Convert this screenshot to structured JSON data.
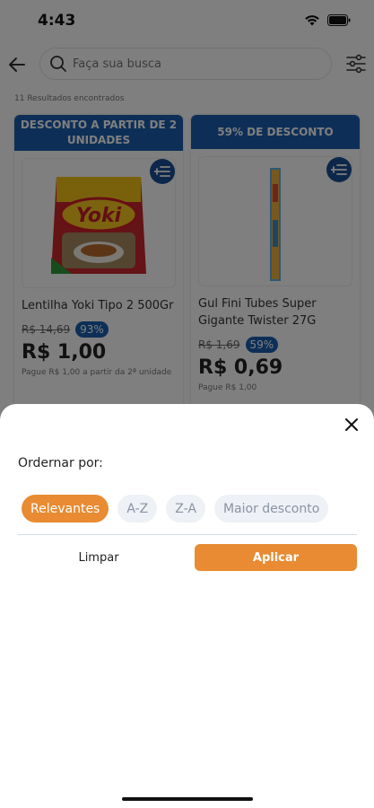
{
  "status_bar": {
    "time": "4:43"
  },
  "search": {
    "placeholder": "Faça sua busca"
  },
  "results": {
    "count_text": "11 Resultados encontrados"
  },
  "products": [
    {
      "banner": "DESCONTO A PARTIR DE 2 UNIDADES",
      "name": "Lentilha Yoki Tipo 2 500Gr",
      "old_price": "R$ 14,69",
      "discount": "93%",
      "price": "R$ 1,00",
      "note": "Pague R$ 1,00 a partir da 2ª unidade",
      "image_text": "Yoki"
    },
    {
      "banner": "59% DE DESCONTO",
      "name": "Gul Fini Tubes Super Gigante Twister 27G",
      "old_price": "R$ 1,69",
      "discount": "59%",
      "price": "R$ 0,69",
      "note": "Pague R$ 1,00"
    }
  ],
  "sort_sheet": {
    "title": "Ordernar por:",
    "options": [
      "Relevantes",
      "A-Z",
      "Z-A",
      "Maior desconto"
    ],
    "selected": "Relevantes",
    "clear_label": "Limpar",
    "apply_label": "Aplicar"
  },
  "colors": {
    "accent": "#e88b32",
    "brand_blue": "#1b5fae",
    "chip_bg": "#eef1f6"
  }
}
